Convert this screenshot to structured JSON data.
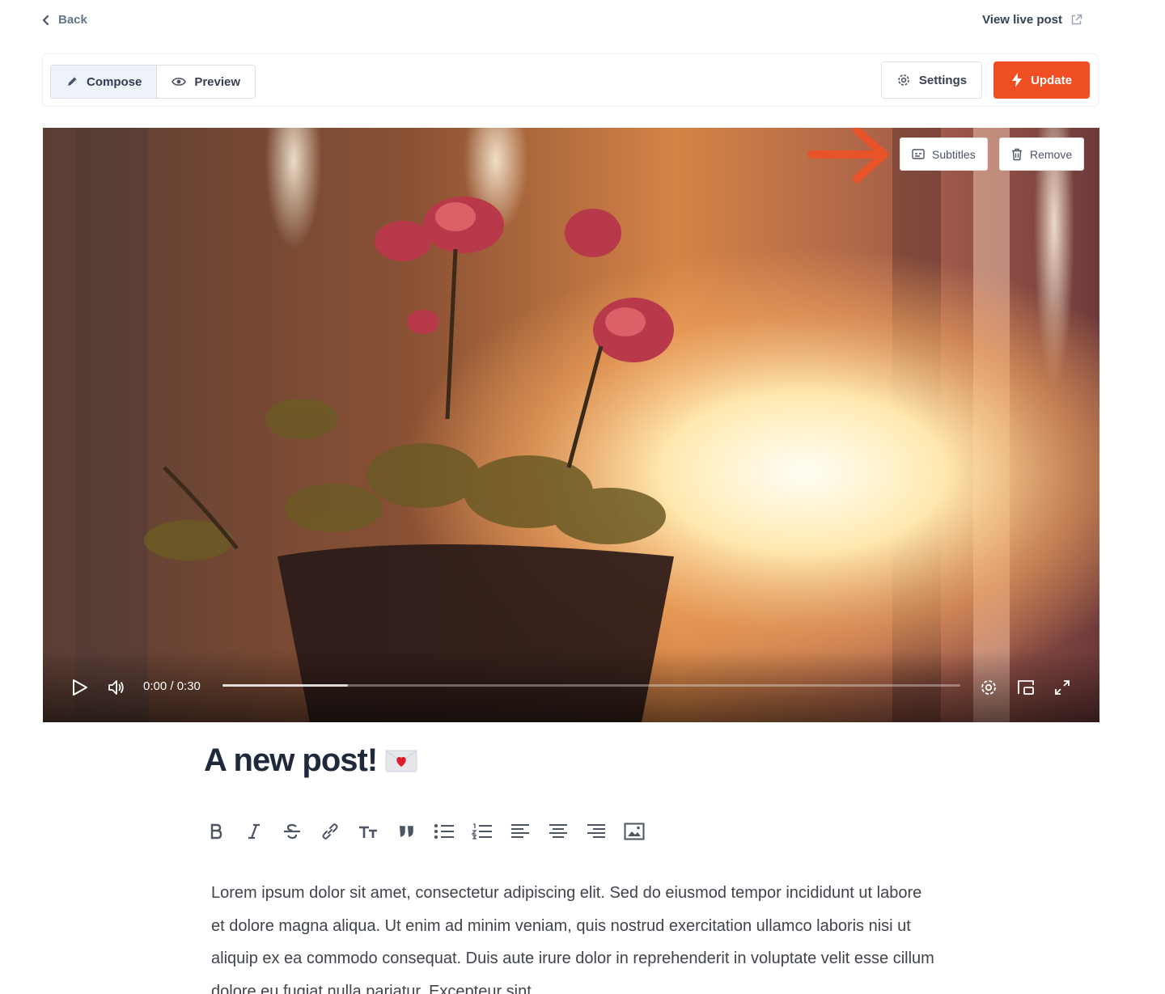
{
  "nav": {
    "back_label": "Back",
    "view_live_label": "View live post"
  },
  "toolbar": {
    "compose_label": "Compose",
    "preview_label": "Preview",
    "settings_label": "Settings",
    "update_label": "Update",
    "active_mode": "Compose"
  },
  "video": {
    "subtitles_label": "Subtitles",
    "remove_label": "Remove",
    "time_display": "0:00 / 0:30",
    "progress": 0.17
  },
  "post": {
    "title": "A new post!",
    "title_emoji": "love-letter-icon",
    "format_tools": [
      "bold",
      "italic",
      "strikethrough",
      "link",
      "heading",
      "quote",
      "bulleted-list",
      "numbered-list",
      "align-left",
      "align-center",
      "align-right",
      "image"
    ],
    "body": "Lorem ipsum dolor sit amet, consectetur adipiscing elit. Sed do eiusmod tempor incididunt ut labore et dolore magna aliqua. Ut enim ad minim veniam, quis nostrud exercitation ullamco laboris nisi ut aliquip ex ea commodo consequat. Duis aute irure dolor in reprehenderit in voluptate velit esse cillum dolore eu fugiat nulla pariatur. Excepteur sint"
  },
  "colors": {
    "accent": "#f04e23",
    "callout_arrow": "#e8532a"
  }
}
